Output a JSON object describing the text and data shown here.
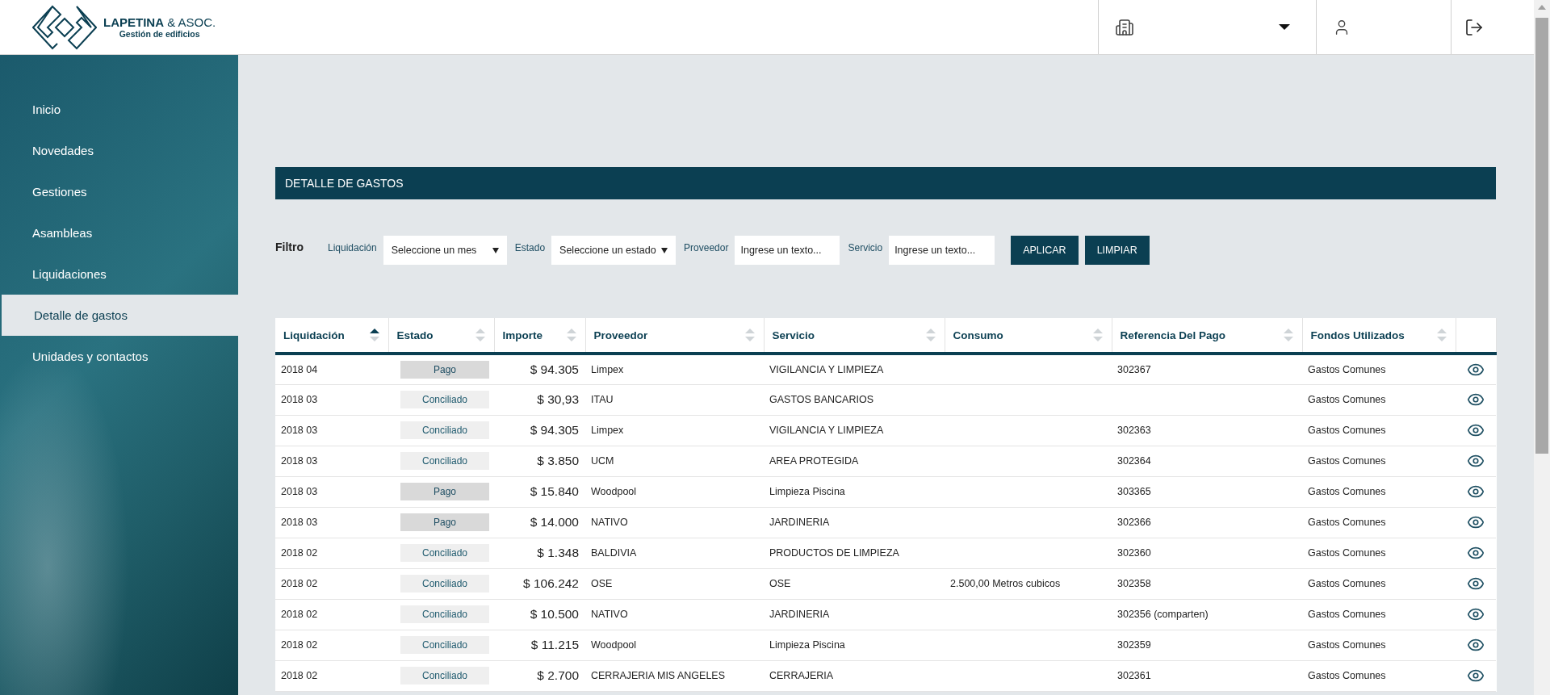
{
  "brand": {
    "name": "**LAPETINA** & ASOC.",
    "tagline": "Gestión de edificios"
  },
  "sidebar": {
    "items": [
      {
        "label": "Inicio",
        "selected": false
      },
      {
        "label": "Novedades",
        "selected": false
      },
      {
        "label": "Gestiones",
        "selected": false
      },
      {
        "label": "Asambleas",
        "selected": false
      },
      {
        "label": "Liquidaciones",
        "selected": false
      },
      {
        "label": "Detalle de gastos",
        "selected": true
      },
      {
        "label": "Unidades y contactos",
        "selected": false
      }
    ]
  },
  "panel": {
    "title": "DETALLE DE GASTOS"
  },
  "filter": {
    "title": "Filtro",
    "fields": [
      {
        "kind": "select",
        "label": "Liquidación",
        "value": "Seleccione un mes"
      },
      {
        "kind": "select",
        "label": "Estado",
        "value": "Seleccione un estado"
      },
      {
        "kind": "text",
        "label": "Proveedor",
        "placeholder": "Ingrese un texto..."
      },
      {
        "kind": "text",
        "label": "Servicio",
        "placeholder": "Ingrese un texto..."
      }
    ],
    "buttons": [
      "APLICAR",
      "LIMPIAR"
    ]
  },
  "table": {
    "columns": [
      {
        "label": "Liquidación",
        "sorted": true
      },
      {
        "label": "Estado",
        "sorted": false
      },
      {
        "label": "Importe",
        "sorted": false
      },
      {
        "label": "Proveedor",
        "sorted": false
      },
      {
        "label": "Servicio",
        "sorted": false
      },
      {
        "label": "Consumo",
        "sorted": false
      },
      {
        "label": "Referencia Del Pago",
        "sorted": false
      },
      {
        "label": "Fondos Utilizados",
        "sorted": false
      }
    ],
    "rows": [
      {
        "liquidacion": "2018 04",
        "estado": "Pago",
        "paid": true,
        "importe": "$ 94.305",
        "proveedor": "Limpex",
        "servicio": "VIGILANCIA Y LIMPIEZA",
        "referencia": "302367",
        "fondos": "Gastos Comunes"
      },
      {
        "liquidacion": "2018 03",
        "estado": "Conciliado",
        "paid": false,
        "importe": "$ 30,93",
        "proveedor": "ITAU",
        "servicio": "GASTOS BANCARIOS",
        "fondos": "Gastos Comunes"
      },
      {
        "liquidacion": "2018 03",
        "estado": "Conciliado",
        "paid": false,
        "importe": "$ 94.305",
        "proveedor": "Limpex",
        "servicio": "VIGILANCIA Y LIMPIEZA",
        "referencia": "302363",
        "fondos": "Gastos Comunes"
      },
      {
        "liquidacion": "2018 03",
        "estado": "Conciliado",
        "paid": false,
        "importe": "$ 3.850",
        "proveedor": "UCM",
        "servicio": "AREA PROTEGIDA",
        "referencia": "302364",
        "fondos": "Gastos Comunes"
      },
      {
        "liquidacion": "2018 03",
        "estado": "Pago",
        "paid": true,
        "importe": "$ 15.840",
        "proveedor": "Woodpool",
        "servicio": "Limpieza Piscina",
        "referencia": "303365",
        "fondos": "Gastos Comunes"
      },
      {
        "liquidacion": "2018 03",
        "estado": "Pago",
        "paid": true,
        "importe": "$ 14.000",
        "proveedor": "NATIVO",
        "servicio": "JARDINERIA",
        "referencia": "302366",
        "fondos": "Gastos Comunes"
      },
      {
        "liquidacion": "2018 02",
        "estado": "Conciliado",
        "paid": false,
        "importe": "$ 1.348",
        "proveedor": "BALDIVIA",
        "servicio": "PRODUCTOS DE LIMPIEZA",
        "referencia": "302360",
        "fondos": "Gastos Comunes"
      },
      {
        "liquidacion": "2018 02",
        "estado": "Conciliado",
        "paid": false,
        "importe": "$ 106.242",
        "proveedor": "OSE",
        "servicio": "OSE",
        "consumo": "2.500,00 Metros cubicos",
        "referencia": "302358",
        "fondos": "Gastos Comunes"
      },
      {
        "liquidacion": "2018 02",
        "estado": "Conciliado",
        "paid": false,
        "importe": "$ 10.500",
        "proveedor": "NATIVO",
        "servicio": "JARDINERIA",
        "referencia": "302356 (comparten)",
        "fondos": "Gastos Comunes"
      },
      {
        "liquidacion": "2018 02",
        "estado": "Conciliado",
        "paid": false,
        "importe": "$ 11.215",
        "proveedor": "Woodpool",
        "servicio": "Limpieza Piscina",
        "referencia": "302359",
        "fondos": "Gastos Comunes"
      },
      {
        "liquidacion": "2018 02",
        "estado": "Conciliado",
        "paid": false,
        "importe": "$ 2.700",
        "proveedor": "CERRAJERIA MIS ANGELES",
        "servicio": "CERRAJERIA",
        "referencia": "302361",
        "fondos": "Gastos Comunes"
      }
    ]
  }
}
